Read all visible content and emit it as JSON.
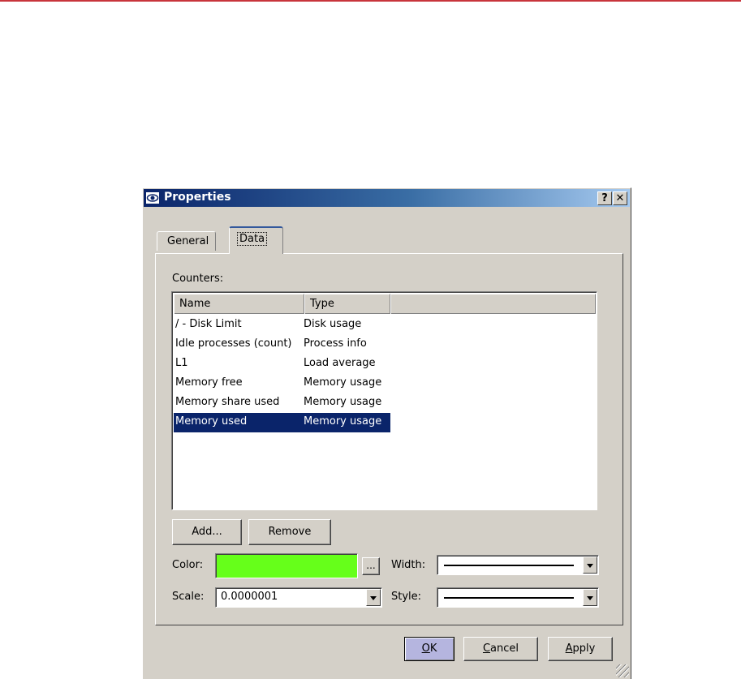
{
  "dialog": {
    "title": "Properties",
    "help_label": "?",
    "close_label": "✕"
  },
  "tabs": [
    {
      "label": "General",
      "active": false
    },
    {
      "label": "Data",
      "active": true
    }
  ],
  "counters": {
    "label": "Counters:",
    "columns": [
      "Name",
      "Type"
    ],
    "rows": [
      {
        "name": "/ - Disk Limit",
        "type": "Disk usage",
        "selected": false
      },
      {
        "name": "Idle processes (count)",
        "type": "Process info",
        "selected": false
      },
      {
        "name": "L1",
        "type": "Load average",
        "selected": false
      },
      {
        "name": "Memory free",
        "type": "Memory usage",
        "selected": false
      },
      {
        "name": "Memory share used",
        "type": "Memory usage",
        "selected": false
      },
      {
        "name": "Memory used",
        "type": "Memory usage",
        "selected": true
      }
    ]
  },
  "buttons": {
    "add": "Add...",
    "remove": "Remove",
    "ellipsis": "...",
    "ok_key": "O",
    "ok_rest": "K",
    "cancel_key": "C",
    "cancel_rest": "ancel",
    "apply_key": "A",
    "apply_rest": "pply"
  },
  "fields": {
    "color_label": "Color:",
    "color_value": "#66ff1a",
    "width_label": "Width:",
    "scale_label": "Scale:",
    "scale_value": "0.0000001",
    "style_label": "Style:"
  },
  "colors": {
    "titlebar_start": "#0a246a",
    "selection": "#0a246a",
    "window_face": "#d4d0c8",
    "accent_rule": "#c8343c"
  },
  "icons": {
    "title_icon": "eye-icon",
    "dropdown": "chevron-down-icon"
  }
}
